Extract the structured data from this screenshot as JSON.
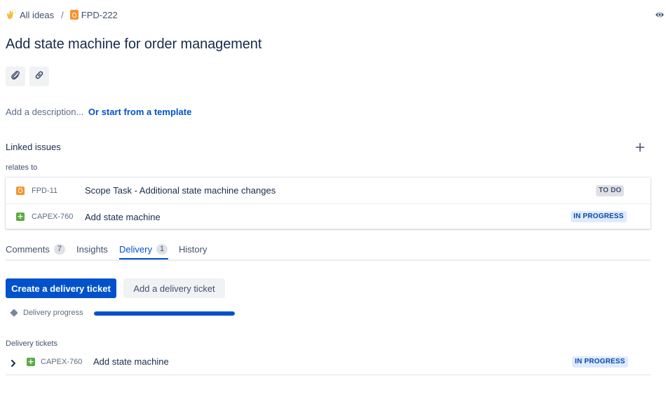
{
  "breadcrumb": {
    "all_ideas": "All ideas",
    "separator": "/",
    "issue_key": "FPD-222"
  },
  "title": "Add state machine for order management",
  "toolbar": {
    "attach_icon": "paperclip-icon",
    "link_icon": "link-icon"
  },
  "description": {
    "placeholder": "Add a description...",
    "template_link": "Or start from a template"
  },
  "linked_issues": {
    "heading": "Linked issues",
    "relation": "relates to",
    "items": [
      {
        "key": "FPD-11",
        "summary": "Scope Task - Additional state machine changes",
        "status": "TO DO",
        "icon": "idea-bulb-icon"
      },
      {
        "key": "CAPEX-760",
        "summary": "Add state machine",
        "status": "IN PROGRESS",
        "icon": "plus-square-icon"
      }
    ]
  },
  "tabs": [
    {
      "label": "Comments",
      "count": "7"
    },
    {
      "label": "Insights",
      "count": ""
    },
    {
      "label": "Delivery",
      "count": "1"
    },
    {
      "label": "History",
      "count": ""
    }
  ],
  "active_tab": "Delivery",
  "delivery": {
    "create_button": "Create a delivery ticket",
    "add_button": "Add a delivery ticket",
    "progress_label": "Delivery progress",
    "progress_fraction": 1.0,
    "tickets_heading": "Delivery tickets",
    "tickets": [
      {
        "key": "CAPEX-760",
        "summary": "Add state machine",
        "status": "IN PROGRESS"
      }
    ]
  },
  "colors": {
    "accent": "#0052cc",
    "todo_bg": "#dfe1e6",
    "progress_bg": "#deebff",
    "story_green": "#5aac44",
    "idea_orange": "#f79232"
  }
}
